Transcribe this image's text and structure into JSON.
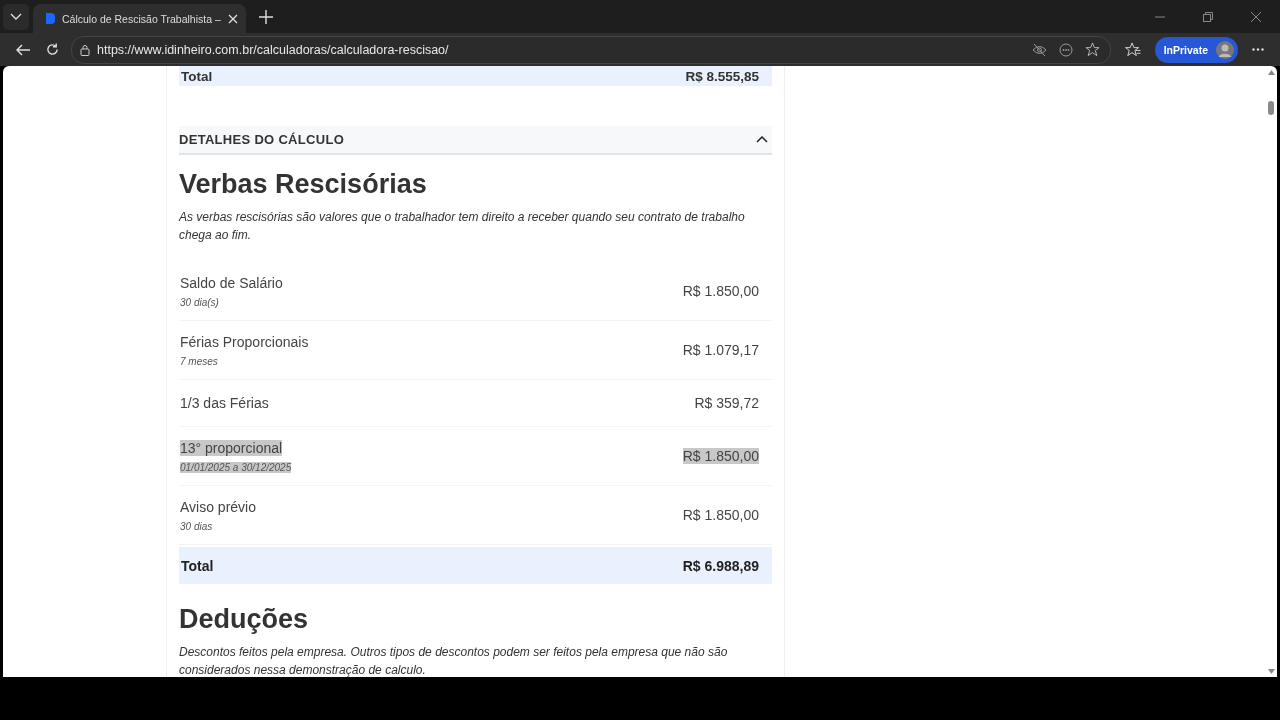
{
  "browser": {
    "tab_title": "Cálculo de Rescisão Trabalhista –",
    "address": "https://www.idinheiro.com.br/calculadoras/calculadora-rescisao/",
    "profile_label": "InPrivate"
  },
  "previous_total": {
    "label": "Total",
    "value": "R$ 8.555,85"
  },
  "details": {
    "title": "DETALHES DO CÁLCULO",
    "expanded": true
  },
  "sections": [
    {
      "heading": "Verbas Rescisórias",
      "description": "As verbas rescisórias são valores que o trabalhador tem direito a receber quando seu contrato de trabalho chega ao fim.",
      "items": [
        {
          "label": "Saldo de Salário",
          "detail": "30 dia(s)",
          "value": "R$ 1.850,00",
          "highlighted": false
        },
        {
          "label": "Férias Proporcionais",
          "detail": "7 meses",
          "value": "R$ 1.079,17",
          "highlighted": false
        },
        {
          "label": "1/3 das Férias",
          "value": "R$ 359,72",
          "highlighted": false
        },
        {
          "label": "13° proporcional",
          "detail": "01/01/2025 a 30/12/2025",
          "value": "R$ 1.850,00",
          "highlighted": true
        },
        {
          "label": "Aviso prévio",
          "detail": "30 dias",
          "value": "R$ 1.850,00",
          "highlighted": false
        }
      ],
      "total": {
        "label": "Total",
        "value": "R$ 6.988,89"
      }
    },
    {
      "heading": "Deduções",
      "description": "Descontos feitos pela empresa. Outros tipos de descontos podem ser feitos pela empresa que não são considerados nessa demonstração de calculo."
    }
  ]
}
